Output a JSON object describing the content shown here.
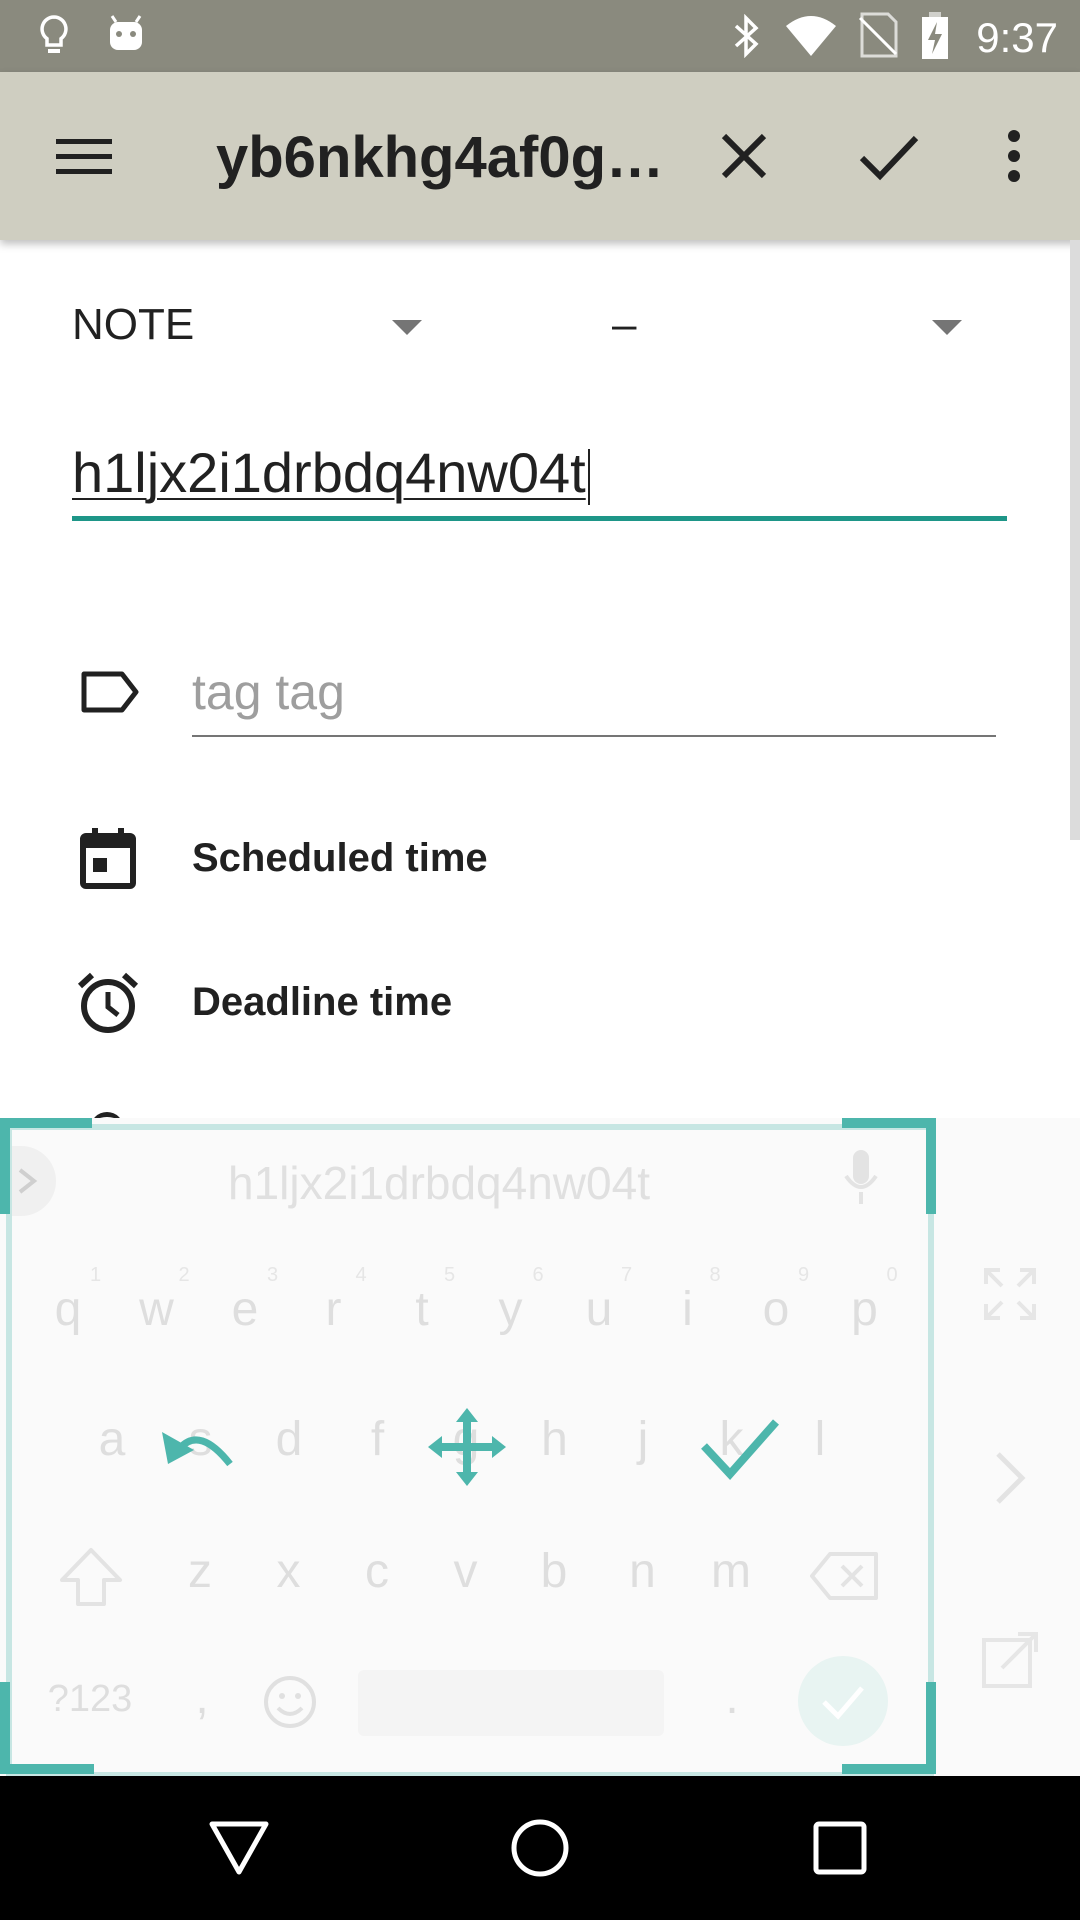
{
  "status_bar": {
    "time": "9:37",
    "left_icons": [
      "lightbulb-icon",
      "android-icon"
    ],
    "right_icons": [
      "bluetooth-icon",
      "wifi-icon",
      "no-sim-icon",
      "battery-charging-icon"
    ]
  },
  "toolbar": {
    "title": "yb6nkhg4af0g…",
    "icons": [
      "menu-icon",
      "close-icon",
      "check-icon",
      "more-vert-icon"
    ],
    "background": "#cfcec1"
  },
  "form": {
    "type_dropdown": "NOTE",
    "priority_dropdown": "–",
    "title_value": "h1ljx2i1drbdq4nw04t",
    "tags_placeholder": "tag tag",
    "scheduled_label": "Scheduled time",
    "deadline_label": "Deadline time",
    "accent": "#1e9688"
  },
  "keyboard": {
    "suggestion": "h1ljx2i1drbdq4nw04t",
    "row1": [
      "q",
      "w",
      "e",
      "r",
      "t",
      "y",
      "u",
      "i",
      "o",
      "p"
    ],
    "row1_numbers": [
      "1",
      "2",
      "3",
      "4",
      "5",
      "6",
      "7",
      "8",
      "9",
      "0"
    ],
    "row2": [
      "a",
      "s",
      "d",
      "f",
      "g",
      "h",
      "j",
      "k",
      "l"
    ],
    "row3": [
      "z",
      "x",
      "c",
      "v",
      "b",
      "n",
      "m"
    ],
    "symbols_key": "?123",
    "comma_key": ",",
    "period_key": ".",
    "overlay_accent": "#4db6ac",
    "overlay_icons": [
      "undo-icon",
      "move-icon",
      "done-icon"
    ]
  },
  "nav_bar": {
    "icons": [
      "back-icon",
      "home-icon",
      "recents-icon"
    ]
  }
}
